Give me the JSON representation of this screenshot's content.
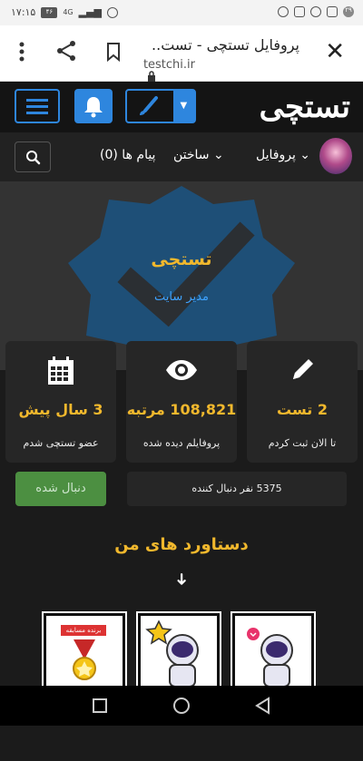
{
  "status_bar": {
    "time": "۱۷:۱۵",
    "battery": "۴۶",
    "network": "4G",
    "right_date": "۲۹"
  },
  "browser": {
    "title": "پروفایل تستچی - تست..",
    "url": "testchi.ir"
  },
  "header": {
    "logo_text": "تستچی"
  },
  "nav": {
    "profile_label": "پروفایل",
    "build_label": "ساختن",
    "messages_label": "پیام ها (0)"
  },
  "profile": {
    "name": "تستچی",
    "role": "مدیر سایت"
  },
  "stats": [
    {
      "value": "2 تست",
      "label": "تا الان ثبت کردم",
      "icon": "pencil-icon"
    },
    {
      "value": "108,821 مرتبه",
      "label": "پروفایلم دیده شده",
      "icon": "eye-icon"
    },
    {
      "value": "3 سال پیش",
      "label": "عضو تستچی شدم",
      "icon": "calendar-icon"
    }
  ],
  "follow": {
    "button_label": "دنبال شده",
    "followers_text": "5375 نفر دنبال کننده"
  },
  "achievements": {
    "title": "دستاورد های من",
    "badge1_text": "برنده مسابقه"
  },
  "colors": {
    "accent": "#f1b82d",
    "link": "#3ea3ff",
    "follow_green": "#4c8f41",
    "header_bg": "#141414"
  }
}
